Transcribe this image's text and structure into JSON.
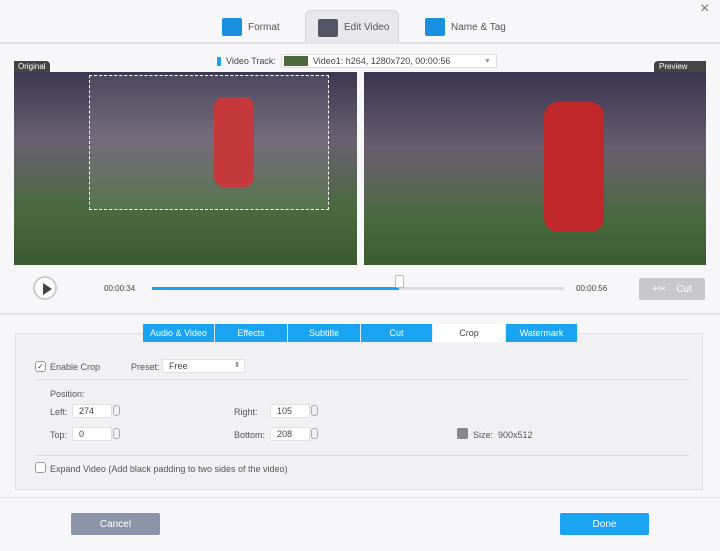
{
  "tabs": [
    {
      "label": "Format"
    },
    {
      "label": "Edit Video"
    },
    {
      "label": "Name & Tag"
    }
  ],
  "close_icon": "×",
  "video_track": {
    "label": "Video Track:",
    "value": "Video1: h264, 1280x720, 00:00:56"
  },
  "original_label": "Original",
  "preview_label": "Preview",
  "player": {
    "current": "00:00:34",
    "total": "00:00:56",
    "progress": 0.6,
    "cut_label": "Cut"
  },
  "edit_tabs": [
    {
      "label": "Audio & Video"
    },
    {
      "label": "Effects"
    },
    {
      "label": "Subtitle"
    },
    {
      "label": "Cut"
    },
    {
      "label": "Crop"
    },
    {
      "label": "Watermark"
    }
  ],
  "crop": {
    "enable_label": "Enable Crop",
    "enabled": true,
    "preset_label": "Preset:",
    "preset_value": "Free",
    "position_label": "Position:",
    "left_label": "Left:",
    "left": "274",
    "top_label": "Top:",
    "top": "0",
    "right_label": "Right:",
    "right": "105",
    "bottom_label": "Bottom:",
    "bottom": "208",
    "size_label": "Size:",
    "size": "900x512",
    "expand_label": "Expand Video (Add black padding to two sides of the video)",
    "expand": false
  },
  "buttons": {
    "cancel": "Cancel",
    "done": "Done"
  },
  "colors": {
    "accent": "#1aa3f0",
    "cancel": "#8b95a8"
  }
}
